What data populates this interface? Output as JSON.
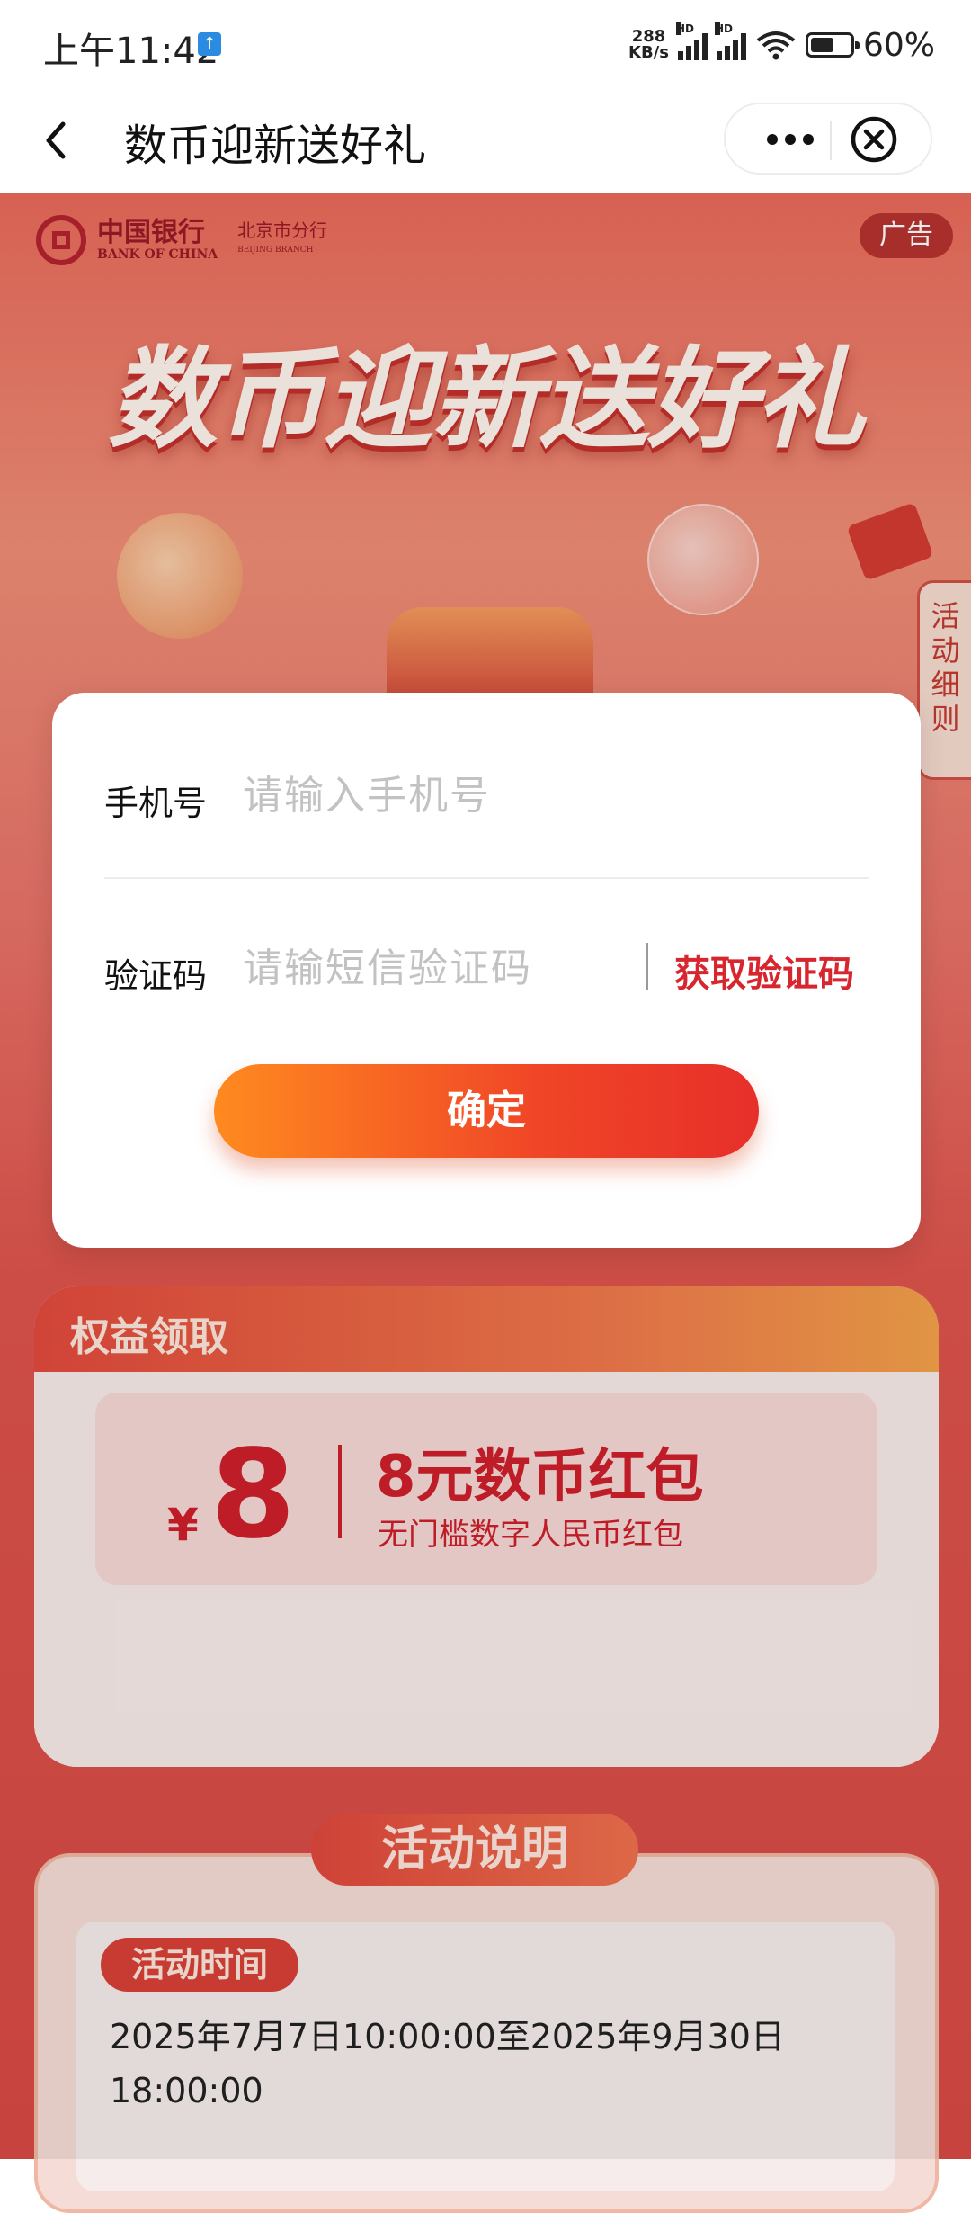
{
  "status_bar": {
    "time": "上午11:42",
    "net_speed_value": "288",
    "net_speed_unit": "KB/s",
    "signal_label": "HD",
    "battery_percent": "60%",
    "battery_level": 0.6
  },
  "nav": {
    "title": "数币迎新送好礼"
  },
  "banner": {
    "bank_name_cn": "中国银行",
    "bank_name_en": "BANK OF CHINA",
    "branch_cn": "北京市分行",
    "branch_en": "BEIJING BRANCH",
    "ad_badge": "广告",
    "hero_title": "数币迎新送好礼",
    "side_tab": "活动细则"
  },
  "modal": {
    "phone_label": "手机号",
    "phone_placeholder": "请输入手机号",
    "code_label": "验证码",
    "code_placeholder": "请输短信验证码",
    "get_code": "获取验证码",
    "confirm": "确定"
  },
  "rights": {
    "title": "权益领取",
    "currency_symbol": "¥",
    "amount": "8",
    "coupon_name": "8元数币红包",
    "coupon_desc": "无门槛数字人民币红包"
  },
  "activity": {
    "title": "活动说明",
    "time_label": "活动时间",
    "time_text": "2025年7月7日10:00:00至2025年9月30日18:00:00"
  },
  "colors": {
    "brand_red": "#d8262e",
    "button_orange": "#ff8a1f"
  }
}
